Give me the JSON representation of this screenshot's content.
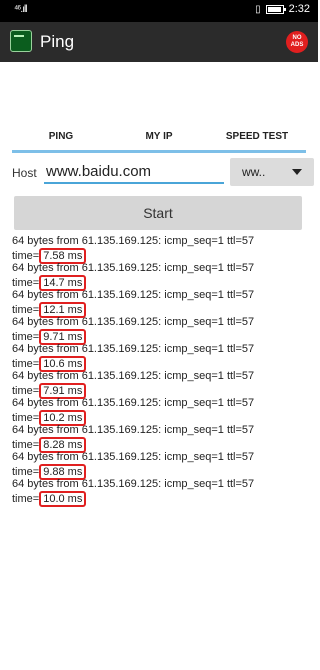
{
  "status_bar": {
    "signal": "⁴⁶.ıll",
    "time": "2:32"
  },
  "app_bar": {
    "title": "Ping",
    "badge_line1": "NO",
    "badge_line2": "ADS"
  },
  "tabs": [
    {
      "label": "PING"
    },
    {
      "label": "MY IP"
    },
    {
      "label": "SPEED TEST"
    }
  ],
  "host": {
    "label": "Host",
    "value": "www.baidu.com",
    "select_value": "ww.."
  },
  "start_button": {
    "label": "Start"
  },
  "results": [
    {
      "line1": "64 bytes from 61.135.169.125: icmp_seq=1 ttl=57",
      "prefix": "time=",
      "rtt": "7.58 ms"
    },
    {
      "line1": "64 bytes from 61.135.169.125: icmp_seq=1 ttl=57",
      "prefix": "time=",
      "rtt": "14.7 ms"
    },
    {
      "line1": "64 bytes from 61.135.169.125: icmp_seq=1 ttl=57",
      "prefix": "time=",
      "rtt": "12.1 ms"
    },
    {
      "line1": "64 bytes from 61.135.169.125: icmp_seq=1 ttl=57",
      "prefix": "time=",
      "rtt": "9.71 ms"
    },
    {
      "line1": "64 bytes from 61.135.169.125: icmp_seq=1 ttl=57",
      "prefix": "time=",
      "rtt": "10.6 ms"
    },
    {
      "line1": "64 bytes from 61.135.169.125: icmp_seq=1 ttl=57",
      "prefix": "time=",
      "rtt": "7.91 ms"
    },
    {
      "line1": "64 bytes from 61.135.169.125: icmp_seq=1 ttl=57",
      "prefix": "time=",
      "rtt": "10.2 ms"
    },
    {
      "line1": "64 bytes from 61.135.169.125: icmp_seq=1 ttl=57",
      "prefix": "time=",
      "rtt": "8.28 ms"
    },
    {
      "line1": "64 bytes from 61.135.169.125: icmp_seq=1 ttl=57",
      "prefix": "time=",
      "rtt": "9.88 ms"
    },
    {
      "line1": "64 bytes from 61.135.169.125: icmp_seq=1 ttl=57",
      "prefix": "time=",
      "rtt": "10.0 ms"
    }
  ],
  "colors": {
    "app_bar": "#2b2b2b",
    "tab_indicator": "#7dbfe8",
    "input_underline": "#4aa5d8",
    "highlight": "#e02020",
    "badge": "#e11f1f"
  }
}
